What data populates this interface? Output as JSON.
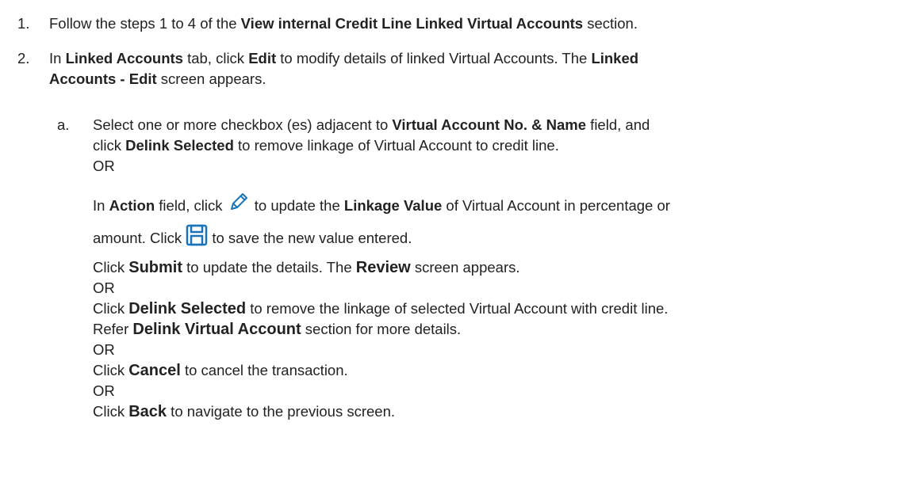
{
  "steps": [
    {
      "number": "1.",
      "t1": "Follow the steps 1 to 4 of the ",
      "b1": "View internal Credit Line Linked Virtual Accounts",
      "t2": " section."
    },
    {
      "number": "2.",
      "t1": "In ",
      "b1": "Linked Accounts",
      "t2": " tab, click ",
      "b2": "Edit",
      "t3": " to modify details of linked Virtual Accounts. The ",
      "b3": "Linked",
      "b4": "Accounts - Edit",
      "t4": " screen appears."
    }
  ],
  "substep_a": {
    "marker": "a.",
    "l1_t1": "Select one or more checkbox (es) adjacent to ",
    "l1_b1": "Virtual Account No. & Name",
    "l1_t2": " field, and",
    "l2_t1": "click ",
    "l2_b1": "Delink Selected",
    "l2_t2": " to remove linkage of Virtual Account to credit line.",
    "or": "OR",
    "l4_t1": "In ",
    "l4_b1": "Action",
    "l4_t2": " field, click ",
    "l4_t3": " to update the ",
    "l4_b2": "Linkage Value",
    "l4_t4": " of Virtual Account in percentage or",
    "l5_t1": "amount. Click ",
    "l5_t2": " to save the new value entered.",
    "l6_t1": "Click ",
    "l6_b1": "Submit",
    "l6_t2": " to update the details. The ",
    "l6_b2": "Review",
    "l6_t3": " screen appears.",
    "l8_t1": "Click ",
    "l8_b1": "Delink Selected",
    "l8_t2": " to remove the linkage of selected Virtual Account with credit line.",
    "l9_t1": "Refer ",
    "l9_b1": "Delink Virtual Account",
    "l9_t2": " section for more details.",
    "l11_t1": "Click ",
    "l11_b1": "Cancel",
    "l11_t2": " to cancel the transaction.",
    "l13_t1": "Click ",
    "l13_b1": "Back",
    "l13_t2": " to navigate to the previous screen."
  },
  "icons": {
    "edit": "pencil-icon",
    "save": "save-icon",
    "icon_color": "#1a73b8"
  }
}
